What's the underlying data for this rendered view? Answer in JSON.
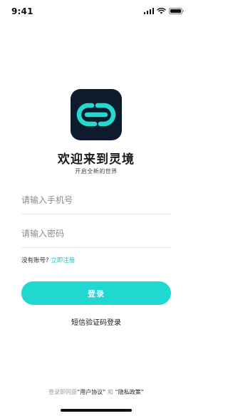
{
  "status_bar": {
    "time": "9:41"
  },
  "app": {
    "icon": "link-logo-icon",
    "title": "欢迎来到灵境",
    "subtitle": "开启全新的世界",
    "accent_color": "#20d8cf",
    "logo_bg": "#0c1c2c"
  },
  "login_form": {
    "phone_placeholder": "请输入手机号",
    "phone_value": "",
    "password_placeholder": "请输入密码",
    "password_value": "",
    "no_account_text": "没有账号?",
    "register_link": "立即注册",
    "login_button": "登录",
    "sms_login": "短信验证码登录"
  },
  "agreement": {
    "prefix": "登录即同意",
    "user_agreement": "“用户协议”",
    "and": "和",
    "privacy_policy": "“隐私政策”"
  }
}
